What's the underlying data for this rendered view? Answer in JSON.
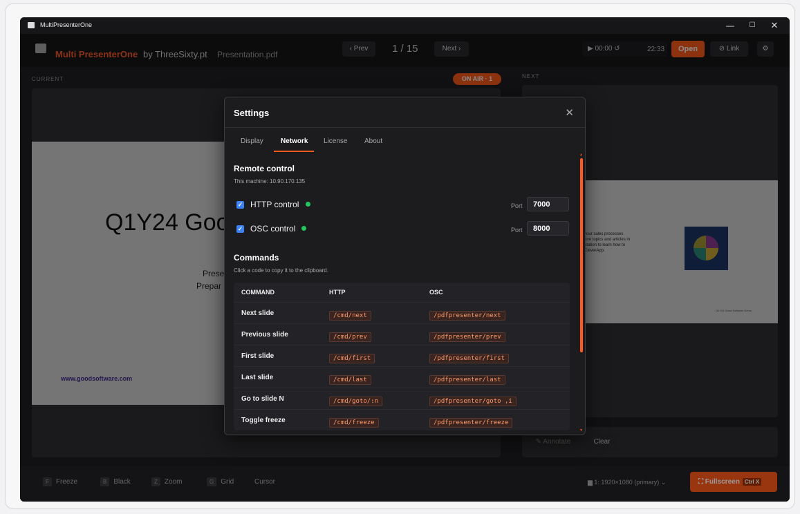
{
  "window": {
    "title": "MultiPresenterOne"
  },
  "header": {
    "brand": "Multi PresenterOne",
    "brand_by": "by ThreeSixty.pt",
    "file": "Presentation.pdf",
    "prev": "‹ Prev",
    "page": "1 / 15",
    "next": "Next ›",
    "timer": "▶  00:00  ↺",
    "timer_total": "22:33",
    "open": "Open",
    "link": "⊘ Link",
    "settings_icon": "⚙"
  },
  "panels": {
    "current_label": "CURRENT",
    "onair": "ON AIR · 1",
    "next_label": "NEXT",
    "current_slide": {
      "headline": "Q1Y24 Goo",
      "sub1": "Prese",
      "sub2": "Prepar",
      "url": "www.goodsoftware.com"
    },
    "next_slide": {
      "text": "your sales processes\nlore topics and articles in\nntation to learn how to\nCleverApp.",
      "footer": "Q1Y24 Good Software Demo"
    },
    "annotate": "✎ Annotate",
    "clear": "Clear"
  },
  "toolbar": {
    "tools": [
      {
        "key": "F",
        "label": "Freeze"
      },
      {
        "key": "B",
        "label": "Black"
      },
      {
        "key": "Z",
        "label": "Zoom"
      },
      {
        "key": "G",
        "label": "Grid"
      },
      {
        "key": "",
        "label": "Cursor"
      }
    ],
    "monitor": "▆  1: 1920×1080 (primary) ⌄",
    "fullscreen": "⛶ Fullscreen",
    "fullscreen_key": "Ctrl X"
  },
  "settings": {
    "title": "Settings",
    "tabs": [
      "Display",
      "Network",
      "License",
      "About"
    ],
    "active_tab": "Network",
    "remote": {
      "title": "Remote control",
      "machine": "This machine: 10.90.170.135",
      "http_label": "HTTP control",
      "osc_label": "OSC control",
      "port_label": "Port",
      "http_port": "7000",
      "osc_port": "8000",
      "status_color": "#22c55e"
    },
    "commands": {
      "title": "Commands",
      "hint": "Click a code to copy it to the clipboard.",
      "headers": [
        "COMMAND",
        "HTTP",
        "OSC"
      ],
      "rows": [
        {
          "name": "Next slide",
          "http": "/cmd/next",
          "osc": "/pdfpresenter/next"
        },
        {
          "name": "Previous slide",
          "http": "/cmd/prev",
          "osc": "/pdfpresenter/prev"
        },
        {
          "name": "First slide",
          "http": "/cmd/first",
          "osc": "/pdfpresenter/first"
        },
        {
          "name": "Last slide",
          "http": "/cmd/last",
          "osc": "/pdfpresenter/last"
        },
        {
          "name": "Go to slide N",
          "http": "/cmd/goto/:n",
          "osc": "/pdfpresenter/goto ,i"
        },
        {
          "name": "Toggle freeze",
          "http": "/cmd/freeze",
          "osc": "/pdfpresenter/freeze"
        }
      ]
    }
  },
  "colors": {
    "accent": "#ff5a1a",
    "checkbox": "#3b82f6"
  }
}
